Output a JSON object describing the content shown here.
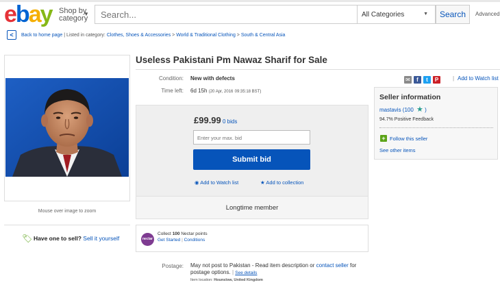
{
  "header": {
    "logo_letters": [
      "e",
      "b",
      "a",
      "y"
    ],
    "shop_by_line1": "Shop by",
    "shop_by_line2": "category",
    "search_placeholder": "Search...",
    "category": "All Categories",
    "search_button": "Search",
    "advanced": "Advanced"
  },
  "breadcrumb": {
    "back_link": "Back to home page",
    "listed_in": "Listed in category:",
    "items": [
      "Clothes, Shoes & Accessories",
      "World & Traditional Clothing",
      "South & Central Asia"
    ]
  },
  "image_panel": {
    "zoom_note": "Mouse over image to zoom",
    "sell_prompt": "Have one to sell?",
    "sell_link": "Sell it yourself"
  },
  "listing": {
    "title": "Useless Pakistani Pm Nawaz Sharif for Sale",
    "condition_label": "Condition:",
    "condition_value": "New with defects",
    "time_left_label": "Time left:",
    "time_left_value": "6d 15h",
    "end_date": "(20 Apr, 2016",
    "end_time": "09:35:18 BST)",
    "watch_link": "Add to Watch list",
    "share_icons": [
      "email-icon",
      "facebook-icon",
      "twitter-icon",
      "pinterest-icon"
    ]
  },
  "bid": {
    "price": "£99.99",
    "bids": "0 bids",
    "max_bid_placeholder": "Enter your max. bid",
    "submit": "Submit bid",
    "add_watch": "Add to Watch list",
    "add_collection": "Add to collection",
    "longtime": "Longtime member"
  },
  "nectar": {
    "logo_text": "nectar",
    "collect_pre": "Collect ",
    "points": "100",
    "collect_post": " Nectar points",
    "get_started": "Get Started",
    "conditions": "Conditions"
  },
  "postage": {
    "label": "Postage:",
    "text_pre": "May not post to Pakistan - Read item description or ",
    "contact_link": "contact seller",
    "text_post": " for postage options. ",
    "see_details": "See details",
    "item_location_label": "Item location:",
    "item_location": "Hounslow, United Kingdom"
  },
  "seller": {
    "heading": "Seller information",
    "name": "mastavis",
    "score": "(100",
    "score_close": ")",
    "feedback": "94.7% Positive Feedback",
    "follow": "Follow this seller",
    "other_items": "See other items"
  },
  "colors": {
    "link": "#0654ba",
    "submit_bg": "#0654ba",
    "logo_e": "#e53238",
    "logo_b": "#0064d2",
    "logo_a": "#f5af02",
    "logo_y": "#86b817"
  }
}
